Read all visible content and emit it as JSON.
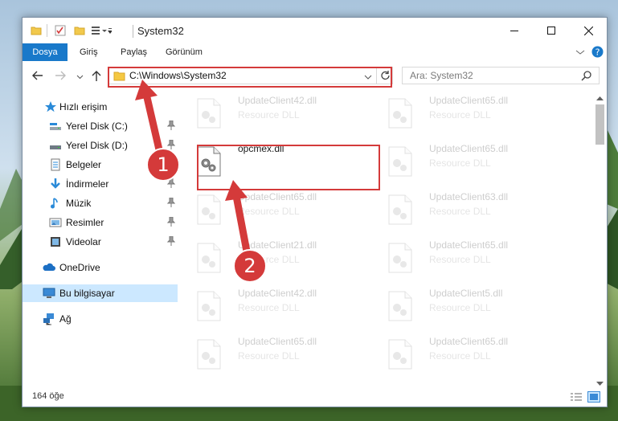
{
  "window": {
    "title": "System32"
  },
  "ribbon": {
    "tabs": [
      {
        "label": "Dosya"
      },
      {
        "label": "Giriş"
      },
      {
        "label": "Paylaş"
      },
      {
        "label": "Görünüm"
      }
    ]
  },
  "address": {
    "path": "C:\\Windows\\System32"
  },
  "search": {
    "placeholder": "Ara: System32"
  },
  "nav": {
    "quick_access": "Hızlı erişim",
    "items": [
      {
        "label": "Yerel Disk (C:)",
        "icon": "drive-icon"
      },
      {
        "label": "Yerel Disk (D:)",
        "icon": "drive-icon"
      },
      {
        "label": "Belgeler",
        "icon": "documents-icon"
      },
      {
        "label": "İndirmeler",
        "icon": "download-icon"
      },
      {
        "label": "Müzik",
        "icon": "music-icon"
      },
      {
        "label": "Resimler",
        "icon": "pictures-icon"
      },
      {
        "label": "Videolar",
        "icon": "videos-icon"
      }
    ],
    "onedrive": "OneDrive",
    "this_pc": "Bu bilgisayar",
    "network": "Ağ"
  },
  "files": [
    {
      "name": "UpdateClient42.dll",
      "type": "Resource DLL"
    },
    {
      "name": "UpdateClient65.dll",
      "type": "Resource DLL"
    },
    {
      "name": "opcmex.dll",
      "type": ""
    },
    {
      "name": "UpdateClient65.dll",
      "type": "Resource DLL"
    },
    {
      "name": "UpdateClient65.dll",
      "type": "Resource DLL"
    },
    {
      "name": "UpdateClient63.dll",
      "type": "Resource DLL"
    },
    {
      "name": "UpdateClient21.dll",
      "type": "Resource DLL"
    },
    {
      "name": "UpdateClient65.dll",
      "type": "Resource DLL"
    },
    {
      "name": "UpdateClient42.dll",
      "type": "Resource DLL"
    },
    {
      "name": "UpdateClient5.dll",
      "type": "Resource DLL"
    },
    {
      "name": "UpdateClient65.dll",
      "type": "Resource DLL"
    },
    {
      "name": "UpdateClient65.dll",
      "type": "Resource DLL"
    }
  ],
  "status": {
    "count": "164 öğe"
  },
  "annotations": {
    "badge1": "1",
    "badge2": "2",
    "color": "#d43a3a"
  }
}
